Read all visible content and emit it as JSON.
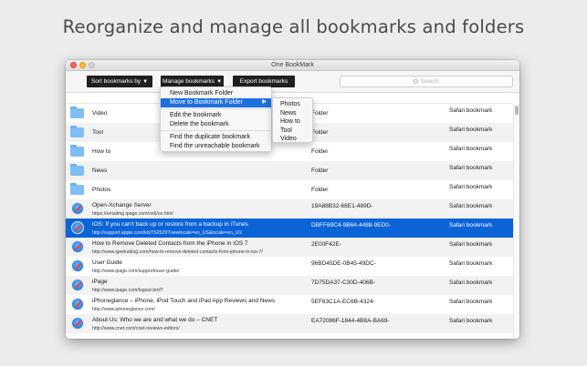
{
  "headline": "Reorganize and manage all bookmarks and folders",
  "window": {
    "title": "One BookMark"
  },
  "toolbar": {
    "sort_label": "Sort bookmarks by",
    "manage_label": "Manage bookmarks",
    "export_label": "Export bookmarks",
    "search_placeholder": "Search"
  },
  "menu": {
    "items": [
      {
        "label": "New Bookmark Folder"
      },
      {
        "label": "Move to Bookmark Folder",
        "highlighted": true,
        "submenu": true
      },
      {
        "label": "Edit the bookmark"
      },
      {
        "label": "Delete the bookmark"
      },
      {
        "label": "Find the duplicate bookmark"
      },
      {
        "label": "Find the unreachable bookmark"
      }
    ],
    "submenu": [
      "Photos",
      "News",
      "How to",
      "Tool",
      "Video"
    ]
  },
  "rows": [
    {
      "kind": "folder",
      "name": "Video",
      "type": "Folder",
      "source": "Safari bookmark"
    },
    {
      "kind": "folder",
      "name": "Tool",
      "type": "Folder",
      "source": "Safari bookmark"
    },
    {
      "kind": "folder",
      "name": "How to",
      "type": "Folder",
      "source": "Safari bookmark"
    },
    {
      "kind": "folder",
      "name": "News",
      "type": "Folder",
      "source": "Safari bookmark"
    },
    {
      "kind": "folder",
      "name": "Photos",
      "type": "Folder",
      "source": "Safari bookmark"
    },
    {
      "kind": "bookmark",
      "name": "Open-Xchange Server",
      "url": "https://emailmg.ipage.com/ox6/ox.html",
      "type": "19A88B32-68E1-489D-",
      "source": "Safari bookmark"
    },
    {
      "kind": "bookmark",
      "name": "iOS: If you can't back up or restore from a backup in iTunes",
      "url": "http://support.apple.com/kb/TS2529?viewlocale=en_US&locale=en_US",
      "type": "DBFF69C4-9B64-4488-9ED0-",
      "source": "Safari bookmark",
      "selected": true
    },
    {
      "kind": "bookmark",
      "name": "How to Remove Deleted Contacts from the iPhone in iOS 7",
      "url": "http://www.igeeksblog.com/how-to-remove-deleted-contacts-from-iphone-in-ios-7/",
      "type": "2E00F42E-",
      "source": "Safari bookmark"
    },
    {
      "kind": "bookmark",
      "name": "User Guide",
      "url": "http://www.ipage.com/support/user-guide/",
      "type": "96BD45DE-0B45-49DC-",
      "source": "Safari bookmark"
    },
    {
      "kind": "bookmark",
      "name": "iPage",
      "url": "http://www.ipage.com/logout.bml?",
      "type": "7D75DA37-C30D-406B-",
      "source": "Safari bookmark"
    },
    {
      "kind": "bookmark",
      "name": "iPhoneglance – iPhone, iPod Touch and iPad App Reviews and News",
      "url": "http://www.iphoneglance.com/",
      "type": "5EF83C1A-EC6B-4324-",
      "source": "Safari bookmark"
    },
    {
      "kind": "bookmark",
      "name": "About Us: Who we are and what we do – CNET",
      "url": "http://www.cnet.com/cnet-reviews-editors/",
      "type": "EA72086F-1844-4B8A-BA69-",
      "source": "Safari bookmark"
    }
  ],
  "colors": {
    "selection": "#0b63d8",
    "menu_highlight": "#1e6fe0",
    "folder": "#7fbff5"
  }
}
